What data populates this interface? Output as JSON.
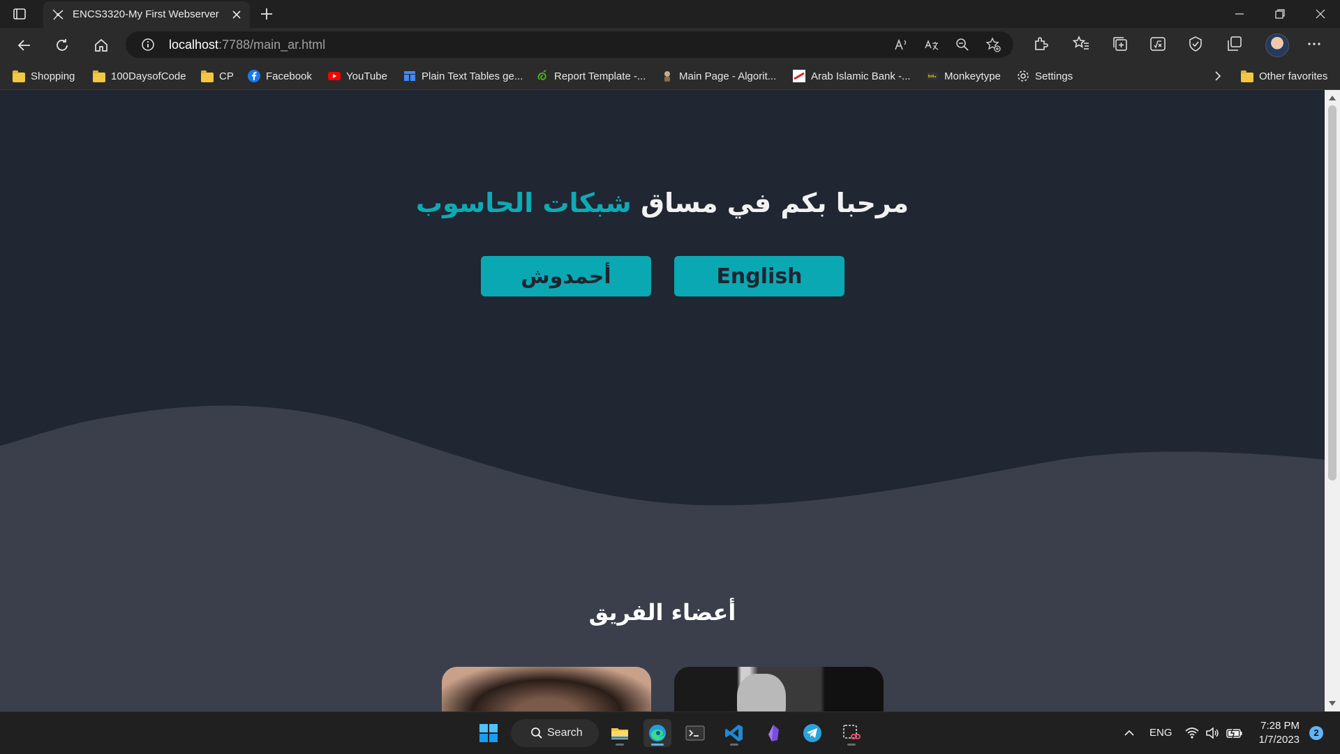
{
  "browser": {
    "tab": {
      "title": "ENCS3320-My First Webserver"
    },
    "address": {
      "host": "localhost",
      "path": ":7788/main_ar.html"
    },
    "bookmarks": [
      {
        "label": "Shopping",
        "icon": "folder-icon"
      },
      {
        "label": "100DaysofCode",
        "icon": "folder-icon"
      },
      {
        "label": "CP",
        "icon": "folder-icon"
      },
      {
        "label": "Facebook",
        "icon": "facebook-icon"
      },
      {
        "label": "YouTube",
        "icon": "youtube-icon"
      },
      {
        "label": "Plain Text Tables ge...",
        "icon": "table-icon"
      },
      {
        "label": "Report Template -...",
        "icon": "overleaf-icon"
      },
      {
        "label": "Main Page - Algorit...",
        "icon": "algorithmica-icon"
      },
      {
        "label": "Arab Islamic Bank -...",
        "icon": "bank-icon"
      },
      {
        "label": "Monkeytype",
        "icon": "monkeytype-icon"
      },
      {
        "label": "Settings",
        "icon": "gear-icon"
      }
    ],
    "other_favorites": "Other favorites"
  },
  "page": {
    "headline_main": "مرحبا بكم في مساق ",
    "headline_accent": "شبكات الحاسوب",
    "buttons": {
      "english": "English",
      "ahmadoush": "أحمدوش"
    },
    "team_title": "أعضاء الفريق"
  },
  "taskbar": {
    "search_label": "Search",
    "language": "ENG",
    "time": "7:28 PM",
    "date": "1/7/2023",
    "notifications": "2"
  },
  "colors": {
    "accent": "#0aa8b3",
    "hero_bg": "#202632",
    "wave_bg": "#3a3f4b"
  }
}
